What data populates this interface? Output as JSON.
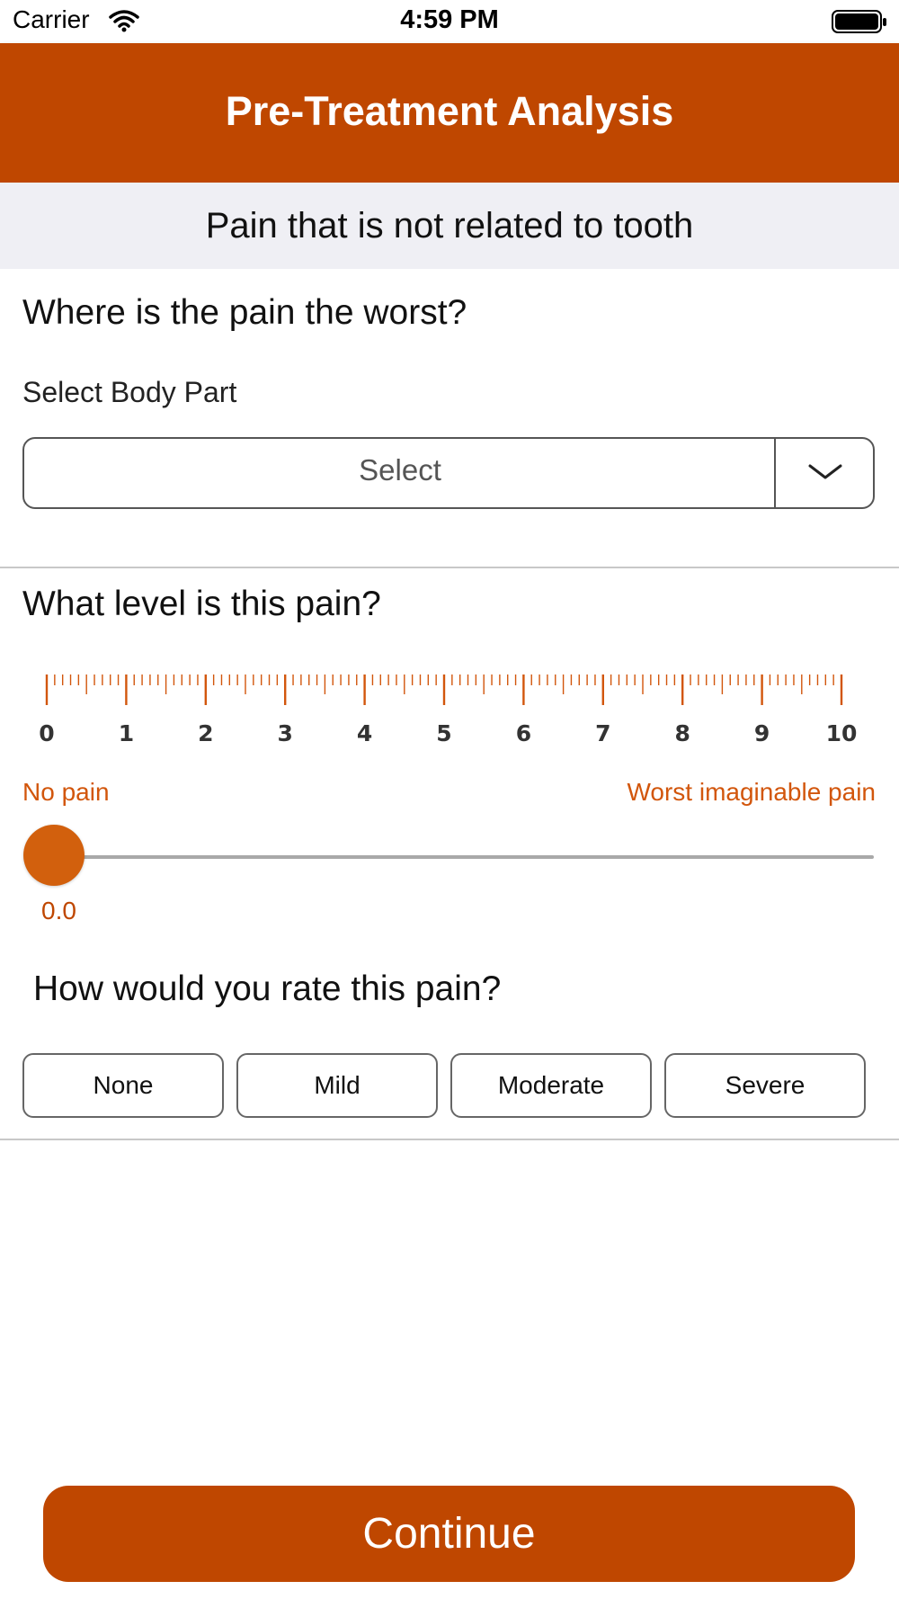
{
  "status_bar": {
    "carrier": "Carrier",
    "time": "4:59 PM",
    "wifi_icon": "wifi-icon",
    "battery_icon": "battery-icon"
  },
  "header": {
    "title": "Pre-Treatment Analysis",
    "color": "#bf4700"
  },
  "section": {
    "title": "Pain that is not related to tooth"
  },
  "location": {
    "question": "Where is the pain the worst?",
    "field_label": "Select Body Part",
    "select_value": "Select",
    "dropdown_icon": "chevron-down-icon"
  },
  "level": {
    "question": "What level is this pain?",
    "ruler_labels": [
      "0",
      "1",
      "2",
      "3",
      "4",
      "5",
      "6",
      "7",
      "8",
      "9",
      "10"
    ],
    "min_label": "No pain",
    "max_label": "Worst imaginable pain",
    "value_text": "0.0",
    "value": 0,
    "min": 0,
    "max": 10,
    "accent_color": "#d2560c"
  },
  "rating": {
    "question": "How would you rate this pain?",
    "options": [
      "None",
      "Mild",
      "Moderate",
      "Severe"
    ]
  },
  "footer": {
    "continue_label": "Continue"
  }
}
